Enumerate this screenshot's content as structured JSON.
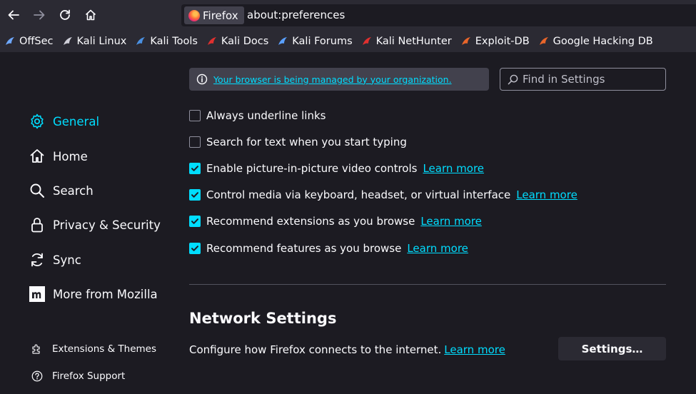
{
  "toolbar": {
    "identity_label": "Firefox",
    "url": "about:preferences"
  },
  "bookmarks": [
    {
      "label": "OffSec",
      "icon": "offsec-icon",
      "color": "#6ea8ff"
    },
    {
      "label": "Kali Linux",
      "icon": "kali-dragon-icon",
      "color": "#cfcfd8"
    },
    {
      "label": "Kali Tools",
      "icon": "kali-tools-icon",
      "color": "#4a90e2"
    },
    {
      "label": "Kali Docs",
      "icon": "kali-docs-icon",
      "color": "#e0302f"
    },
    {
      "label": "Kali Forums",
      "icon": "kali-forums-icon",
      "color": "#5aa0ff"
    },
    {
      "label": "Kali NetHunter",
      "icon": "nethunter-icon",
      "color": "#e0302f"
    },
    {
      "label": "Exploit-DB",
      "icon": "exploit-db-icon",
      "color": "#e8652a"
    },
    {
      "label": "Google Hacking DB",
      "icon": "ghdb-icon",
      "color": "#e8652a"
    }
  ],
  "notice": {
    "text": "Your browser is being managed by your organization."
  },
  "search": {
    "placeholder": "Find in Settings"
  },
  "sidebar": {
    "categories": [
      {
        "label": "General",
        "icon": "gear-icon",
        "selected": true
      },
      {
        "label": "Home",
        "icon": "home-icon"
      },
      {
        "label": "Search",
        "icon": "search-icon"
      },
      {
        "label": "Privacy & Security",
        "icon": "lock-icon"
      },
      {
        "label": "Sync",
        "icon": "sync-icon"
      },
      {
        "label": "More from Mozilla",
        "icon": "mozilla-icon"
      }
    ],
    "footer": [
      {
        "label": "Extensions & Themes",
        "icon": "puzzle-icon"
      },
      {
        "label": "Firefox Support",
        "icon": "help-icon"
      }
    ]
  },
  "options": [
    {
      "label": "Always underline links",
      "checked": false
    },
    {
      "label": "Search for text when you start typing",
      "checked": false
    },
    {
      "label": "Enable picture-in-picture video controls",
      "checked": true,
      "learn_more": "Learn more"
    },
    {
      "label": "Control media via keyboard, headset, or virtual interface",
      "checked": true,
      "learn_more": "Learn more"
    },
    {
      "label": "Recommend extensions as you browse",
      "checked": true,
      "learn_more": "Learn more"
    },
    {
      "label": "Recommend features as you browse",
      "checked": true,
      "learn_more": "Learn more"
    }
  ],
  "network": {
    "title": "Network Settings",
    "description": "Configure how Firefox connects to the internet.",
    "learn_more": "Learn more",
    "button_label": "Settings…"
  },
  "colors": {
    "accent": "#00ddff",
    "background": "#1c1b22",
    "toolbar": "#2b2a33"
  }
}
